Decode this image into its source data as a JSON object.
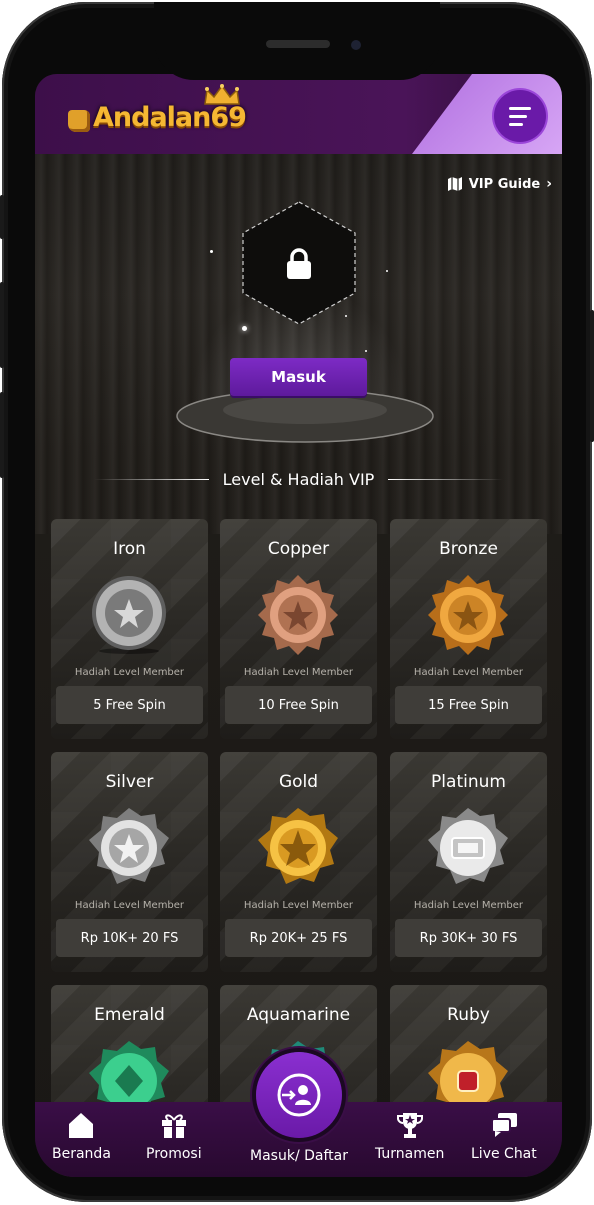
{
  "header": {
    "brand": "Andalan69",
    "menu_icon": "hamburger-menu-icon"
  },
  "vip_guide": {
    "label": "VIP Guide",
    "icon": "map-icon"
  },
  "hero": {
    "lock_icon": "lock-icon",
    "login_button": "Masuk"
  },
  "section": {
    "title": "Level & Hadiah VIP"
  },
  "levels": [
    {
      "name": "Iron",
      "caption": "Hadiah Level Member",
      "reward": "5 Free Spin",
      "color": "#9a9a9a"
    },
    {
      "name": "Copper",
      "caption": "Hadiah Level Member",
      "reward": "10 Free Spin",
      "color": "#c98a66"
    },
    {
      "name": "Bronze",
      "caption": "Hadiah Level Member",
      "reward": "15 Free Spin",
      "color": "#d8902e"
    },
    {
      "name": "Silver",
      "caption": "Hadiah Level Member",
      "reward": "Rp 10K+ 20 FS",
      "color": "#c8c8c8"
    },
    {
      "name": "Gold",
      "caption": "Hadiah Level Member",
      "reward": "Rp 20K+ 25 FS",
      "color": "#e8a624"
    },
    {
      "name": "Platinum",
      "caption": "Hadiah Level Member",
      "reward": "Rp 30K+ 30 FS",
      "color": "#d9d9d9"
    },
    {
      "name": "Emerald",
      "color": "#2fb37b"
    },
    {
      "name": "Aquamarine",
      "color": "#2fbfa0"
    },
    {
      "name": "Ruby",
      "color": "#e0a030"
    }
  ],
  "bottom_nav": {
    "home": "Beranda",
    "promo": "Promosi",
    "login": "Masuk/ Daftar",
    "tournament": "Turnamen",
    "chat": "Live Chat"
  }
}
